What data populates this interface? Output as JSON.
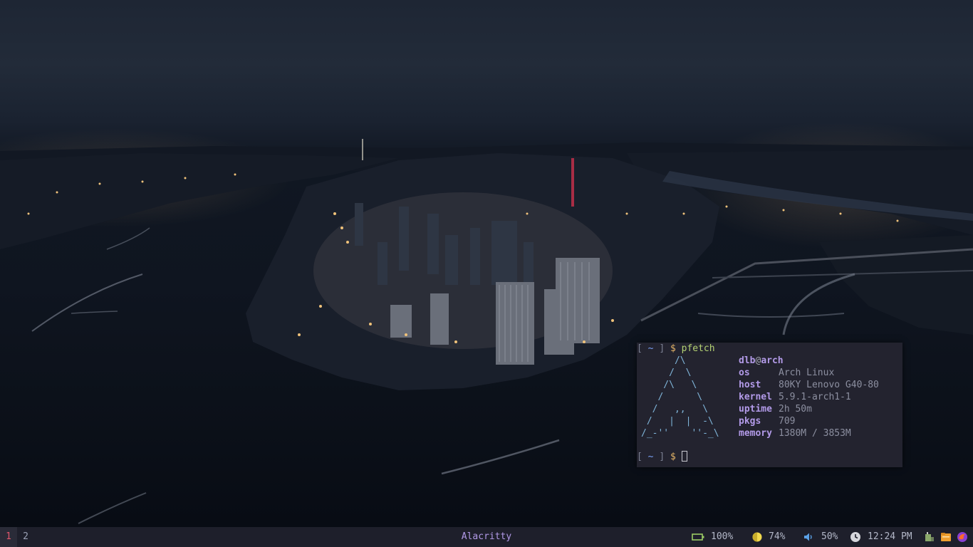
{
  "terminal": {
    "prompt_bracket_open": "[",
    "prompt_tilde": "~",
    "prompt_bracket_close": "]",
    "prompt_dollar": "$",
    "command": "pfetch",
    "logo_ascii": "      /\\\n     /  \\\n    /\\   \\\n   /      \\\n  /   ,,   \\\n /   |  |  -\\\n/_-''    ''-_\\",
    "user": "dlb",
    "at": "@",
    "hostname": "arch",
    "info": [
      {
        "key": "os",
        "value": "Arch Linux"
      },
      {
        "key": "host",
        "value": "80KY Lenovo G40-80"
      },
      {
        "key": "kernel",
        "value": "5.9.1-arch1-1"
      },
      {
        "key": "uptime",
        "value": "2h 50m"
      },
      {
        "key": "pkgs",
        "value": "709"
      },
      {
        "key": "memory",
        "value": "1380M / 3853M"
      }
    ]
  },
  "bar": {
    "workspaces": [
      "1",
      "2"
    ],
    "active_workspace": "1",
    "window_title": "Alacritty",
    "battery": "100%",
    "brightness": "74%",
    "volume": "50%",
    "time": "12:24 PM",
    "tray": [
      "network-manager-icon",
      "files-icon",
      "firefox-icon"
    ]
  },
  "colors": {
    "accent_purple": "#b29ae8",
    "workspace_active": "#e0566b",
    "battery_green": "#9ccc65",
    "brightness_yellow": "#f2d94e",
    "volume_blue": "#5aa0e6"
  }
}
